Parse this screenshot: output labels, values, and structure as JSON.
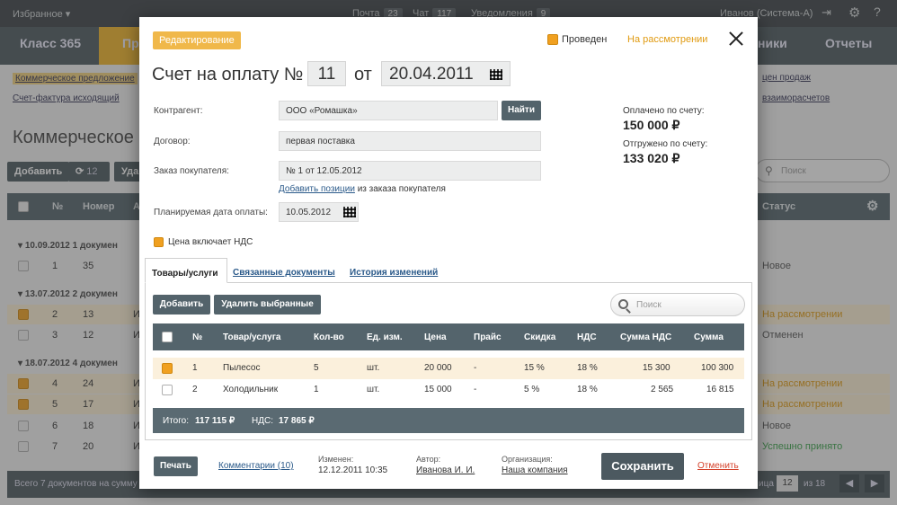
{
  "topbar": {
    "favorites": "Избранное",
    "mail": "Почта",
    "mail_count": "23",
    "chat": "Чат",
    "chat_count": "117",
    "notifications": "Уведомления",
    "notifications_count": "9",
    "user": "Иванов (Система-А)"
  },
  "nav": {
    "brand": "Класс 365",
    "item2": "Пр",
    "item_right1": "ники",
    "item_right2": "Отчеты"
  },
  "sublinks": {
    "l1": "Коммерческое предложение",
    "l2": "Счет-фактура исходящий",
    "r1": "цен продаж",
    "r2": "взаиморасчетов"
  },
  "bg": {
    "title": "Коммерческое п",
    "add": "Добавить",
    "refresh_count": "12",
    "del": "Уда",
    "search_placeholder": "Поиск",
    "headers": {
      "num": "№",
      "number": "Номер",
      "a": "А",
      "status": "Статус"
    },
    "groups": [
      {
        "label": "10.09.2012   1 докумен"
      },
      {
        "label": "13.07.2012   2 докумен"
      },
      {
        "label": "18.07.2012   4 докумен"
      }
    ],
    "rows": [
      {
        "n": "1",
        "num": "35",
        "a": "",
        "status": "Новое"
      },
      {
        "n": "2",
        "num": "13",
        "a": "И",
        "status": "На рассмотрении"
      },
      {
        "n": "3",
        "num": "12",
        "a": "И",
        "status": "Отменен"
      },
      {
        "n": "4",
        "num": "24",
        "a": "И",
        "status": "На рассмотрении"
      },
      {
        "n": "5",
        "num": "17",
        "a": "И",
        "status": "На рассмотрении"
      },
      {
        "n": "6",
        "num": "18",
        "a": "И",
        "status": "Новое"
      },
      {
        "n": "7",
        "num": "20",
        "a": "И",
        "status": "Успешно принято"
      }
    ],
    "footer_total": "Всего 7 документов на сумму",
    "page_label": "ица",
    "page": "12",
    "page_of": "из 18"
  },
  "modal": {
    "badge": "Редактирование",
    "status_label": "Проведен",
    "review_link": "На рассмотрении",
    "title": "Счет на оплату №",
    "number": "11",
    "from": "от",
    "date": "20.04.2011",
    "contractor_label": "Контрагент:",
    "contractor_value": "ООО «Ромашка»",
    "find_btn": "Найти",
    "contract_label": "Договор:",
    "contract_value": "первая поставка",
    "order_label": "Заказ покупателя:",
    "order_value": "№ 1 от 12.05.2012",
    "add_positions_link": "Добавить позиции",
    "add_positions_rest": "из заказа покупателя",
    "pay_date_label": "Планируемая дата оплаты:",
    "pay_date_value": "10.05.2012",
    "paid_label": "Оплачено по счету:",
    "paid_value": "150 000 ₽",
    "shipped_label": "Отгружено по счету:",
    "shipped_value": "133 020 ₽",
    "vat_included": "Цена включает НДС",
    "tabs": [
      "Товары/услуги",
      "Связанные документы",
      "История изменений"
    ],
    "add_btn": "Добавить",
    "delete_btn": "Удалить выбранные",
    "search_placeholder": "Поиск",
    "columns": [
      "№",
      "Товар/услуга",
      "Кол-во",
      "Ед. изм.",
      "Цена",
      "Прайс",
      "Скидка",
      "НДС",
      "Сумма НДС",
      "Сумма"
    ],
    "items": [
      {
        "n": "1",
        "name": "Пылесос",
        "qty": "5",
        "unit": "шт.",
        "price": "20 000",
        "pricelist": "-",
        "discount": "15 %",
        "vat": "18 %",
        "vat_sum": "15 300",
        "sum": "100 300",
        "checked": true
      },
      {
        "n": "2",
        "name": "Холодильник",
        "qty": "1",
        "unit": "шт.",
        "price": "15 000",
        "pricelist": "-",
        "discount": "5 %",
        "vat": "18 %",
        "vat_sum": "2 565",
        "sum": "16 815",
        "checked": false
      }
    ],
    "total_label": "Итого:",
    "total_value": "117 115 ₽",
    "vat_total_label": "НДС:",
    "vat_total_value": "17 865 ₽",
    "print_btn": "Печать",
    "comments_link": "Комментарии (10)",
    "changed_label": "Изменен:",
    "changed_value": "12.12.2011 10:35",
    "author_label": "Автор:",
    "author_value": "Иванова И. И.",
    "org_label": "Организация:",
    "org_value": "Наша компания",
    "save_btn": "Сохранить",
    "cancel_link": "Отменить"
  }
}
